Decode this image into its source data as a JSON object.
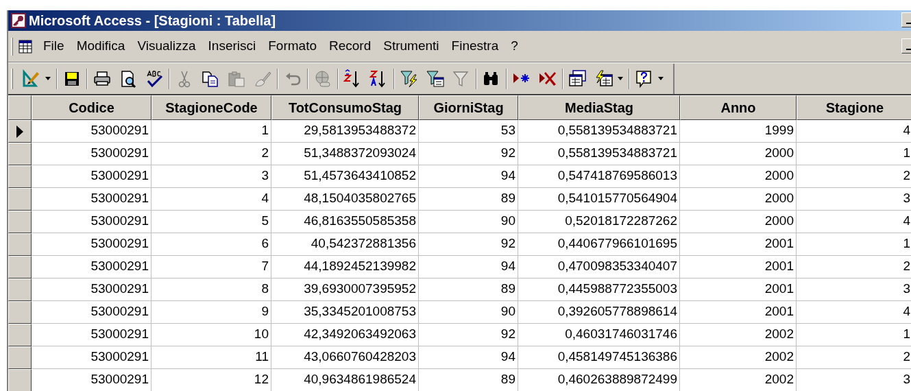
{
  "window": {
    "title": "Microsoft Access - [Stagioni : Tabella]"
  },
  "menu": [
    "File",
    "Modifica",
    "Visualizza",
    "Inserisci",
    "Formato",
    "Record",
    "Strumenti",
    "Finestra",
    "?"
  ],
  "toolbar": [
    {
      "disabled": false
    },
    {
      "disabled": false
    },
    {
      "disabled": false
    },
    {
      "disabled": false
    },
    {
      "disabled": false
    },
    {
      "disabled": true
    },
    {
      "disabled": false
    },
    {
      "disabled": true
    },
    {
      "disabled": true
    },
    {
      "disabled": true
    },
    {
      "disabled": true
    },
    {
      "disabled": false
    },
    {
      "disabled": false
    },
    {
      "disabled": false
    },
    {
      "disabled": false
    },
    {
      "disabled": true
    },
    {
      "disabled": false
    },
    {
      "disabled": false
    },
    {
      "disabled": false
    },
    {
      "disabled": false
    },
    {
      "disabled": false
    },
    {
      "disabled": false
    }
  ],
  "table": {
    "columns": [
      "Codice",
      "StagioneCode",
      "TotConsumoStag",
      "GiorniStag",
      "MediaStag",
      "Anno",
      "Stagione"
    ],
    "rows": [
      {
        "current": true,
        "cells": [
          "53000291",
          "1",
          "29,5813953488372",
          "53",
          "0,558139534883721",
          "1999",
          "4"
        ]
      },
      {
        "current": false,
        "cells": [
          "53000291",
          "2",
          "51,3488372093024",
          "92",
          "0,558139534883721",
          "2000",
          "1"
        ]
      },
      {
        "current": false,
        "cells": [
          "53000291",
          "3",
          "51,4573643410852",
          "94",
          "0,547418769586013",
          "2000",
          "2"
        ]
      },
      {
        "current": false,
        "cells": [
          "53000291",
          "4",
          "48,1504035802765",
          "89",
          "0,541015770564904",
          "2000",
          "3"
        ]
      },
      {
        "current": false,
        "cells": [
          "53000291",
          "5",
          "46,8163550585358",
          "90",
          "0,52018172287262",
          "2000",
          "4"
        ]
      },
      {
        "current": false,
        "cells": [
          "53000291",
          "6",
          "40,542372881356",
          "92",
          "0,440677966101695",
          "2001",
          "1"
        ]
      },
      {
        "current": false,
        "cells": [
          "53000291",
          "7",
          "44,1892452139982",
          "94",
          "0,470098353340407",
          "2001",
          "2"
        ]
      },
      {
        "current": false,
        "cells": [
          "53000291",
          "8",
          "39,6930007395952",
          "89",
          "0,445988772355003",
          "2001",
          "3"
        ]
      },
      {
        "current": false,
        "cells": [
          "53000291",
          "9",
          "35,3345201008753",
          "90",
          "0,392605778898614",
          "2001",
          "4"
        ]
      },
      {
        "current": false,
        "cells": [
          "53000291",
          "10",
          "42,3492063492063",
          "92",
          "0,46031746031746",
          "2002",
          "1"
        ]
      },
      {
        "current": false,
        "cells": [
          "53000291",
          "11",
          "43,0660760428203",
          "94",
          "0,458149745136386",
          "2002",
          "2"
        ]
      },
      {
        "current": false,
        "cells": [
          "53000291",
          "12",
          "40,9634861986524",
          "89",
          "0,460263889872499",
          "2002",
          "3"
        ]
      }
    ]
  }
}
